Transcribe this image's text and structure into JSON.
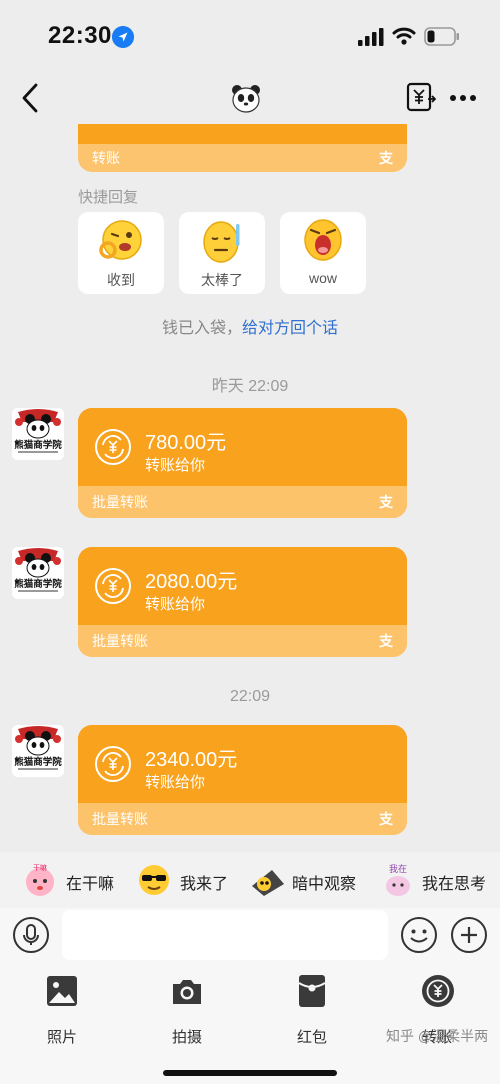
{
  "status_bar": {
    "time": "22:30"
  },
  "nav": {
    "title_icon": "panda-icon",
    "back_icon": "chevron-left-icon",
    "record_icon": "yuan-exchange-icon",
    "more_icon": "ellipsis-icon"
  },
  "partial_card": {
    "footer_label": "转账",
    "alipay_mark": "支"
  },
  "quick_reply": {
    "label": "快捷回复",
    "items": [
      {
        "label": "收到",
        "icon": "ok-emoji-icon"
      },
      {
        "label": "太棒了",
        "icon": "sweat-emoji-icon"
      },
      {
        "label": "wow",
        "icon": "wow-emoji-icon"
      }
    ]
  },
  "received_tip": {
    "text": "钱已入袋，",
    "link": "给对方回个话"
  },
  "messages": [
    {
      "timestamp": "昨天 22:09",
      "amount": "780.00元",
      "desc": "转账给你",
      "footer": "批量转账",
      "alipay_mark": "支"
    },
    {
      "timestamp": "",
      "amount": "2080.00元",
      "desc": "转账给你",
      "footer": "批量转账",
      "alipay_mark": "支"
    },
    {
      "timestamp": "22:09",
      "amount": "2340.00元",
      "desc": "转账给你",
      "footer": "批量转账",
      "alipay_mark": "支"
    }
  ],
  "avatar_text": "熊猫商学院",
  "stickers": [
    {
      "label": "在干嘛",
      "icon": "baby-sticker-icon"
    },
    {
      "label": "我来了",
      "icon": "sunglasses-sticker-icon"
    },
    {
      "label": "暗中观察",
      "icon": "peek-sticker-icon"
    },
    {
      "label": "我在思考",
      "icon": "thinking-sticker-icon"
    }
  ],
  "input": {
    "value": "",
    "placeholder": ""
  },
  "toolbar": [
    {
      "label": "照片",
      "icon": "photo-icon"
    },
    {
      "label": "拍摄",
      "icon": "camera-icon"
    },
    {
      "label": "红包",
      "icon": "red-packet-icon"
    },
    {
      "label": "转账",
      "icon": "transfer-icon"
    }
  ],
  "watermark": "知乎 @温柔半两",
  "colors": {
    "card_orange": "#f8a21e",
    "card_footer": "#fcc36b",
    "link_blue": "#2f6fd0",
    "background": "#ededed"
  }
}
